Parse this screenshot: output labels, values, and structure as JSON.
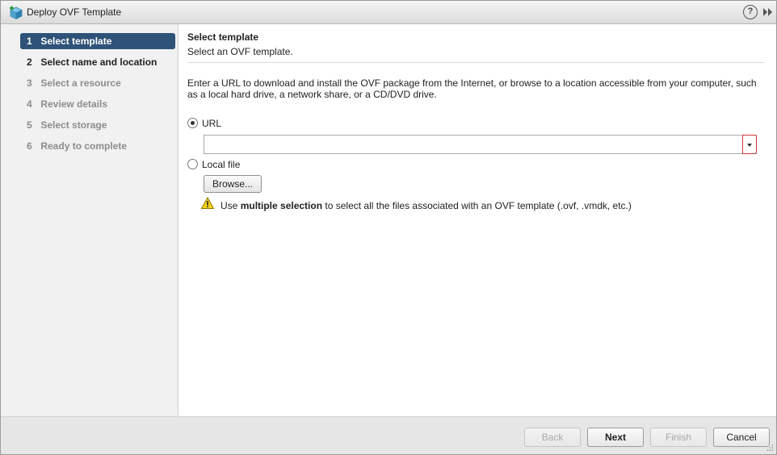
{
  "window": {
    "title": "Deploy OVF Template",
    "help_label": "?"
  },
  "steps": [
    {
      "num": "1",
      "label": "Select template",
      "state": "active"
    },
    {
      "num": "2",
      "label": "Select name and location",
      "state": "enabled"
    },
    {
      "num": "3",
      "label": "Select a resource",
      "state": "disabled"
    },
    {
      "num": "4",
      "label": "Review details",
      "state": "disabled"
    },
    {
      "num": "5",
      "label": "Select storage",
      "state": "disabled"
    },
    {
      "num": "6",
      "label": "Ready to complete",
      "state": "disabled"
    }
  ],
  "content": {
    "heading": "Select template",
    "subheading": "Select an OVF template.",
    "description": "Enter a URL to download and install the OVF package from the Internet, or browse to a location accessible from your computer, such as a local hard drive, a network share, or a CD/DVD drive.",
    "url_option": {
      "label": "URL",
      "selected": true,
      "value": "",
      "placeholder": ""
    },
    "local_option": {
      "label": "Local file",
      "selected": false
    },
    "browse_label": "Browse...",
    "warning": {
      "prefix": "Use ",
      "bold": "multiple selection",
      "suffix": " to select all the files associated with an OVF template (.ovf, .vmdk, etc.)"
    }
  },
  "footer": {
    "back_label": "Back",
    "next_label": "Next",
    "finish_label": "Finish",
    "cancel_label": "Cancel"
  },
  "colors": {
    "active_step_bg": "#2e5278",
    "error_border": "#d0343a",
    "warning_yellow": "#f5d21c"
  }
}
